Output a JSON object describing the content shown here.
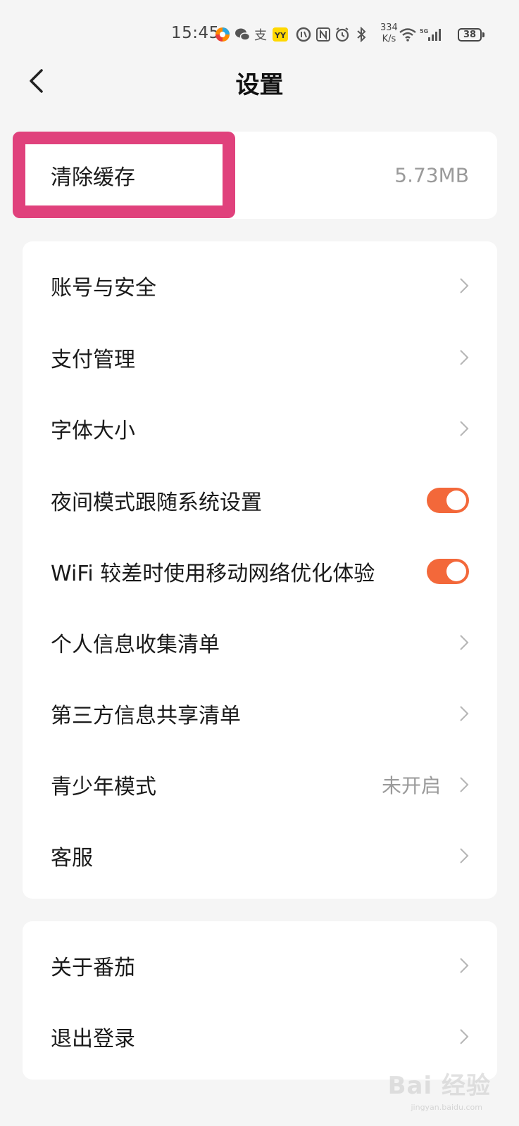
{
  "status_bar": {
    "time": "15:45",
    "net_speed_value": "334",
    "net_speed_unit": "K/s",
    "network": "5G",
    "battery": "38",
    "icons": [
      "app-icon",
      "wechat-icon",
      "alipay-icon",
      "yy-icon",
      "battery-saver-icon",
      "nfc-icon",
      "alarm-icon",
      "bluetooth-icon",
      "wifi-icon",
      "signal-icon"
    ]
  },
  "header": {
    "title": "设置"
  },
  "cache_card": {
    "label": "清除缓存",
    "size": "5.73MB"
  },
  "settings_card": {
    "items": [
      {
        "label": "账号与安全",
        "control": "chevron"
      },
      {
        "label": "支付管理",
        "control": "chevron"
      },
      {
        "label": "字体大小",
        "control": "chevron"
      },
      {
        "label": "夜间模式跟随系统设置",
        "control": "toggle",
        "on": true
      },
      {
        "label": "WiFi 较差时使用移动网络优化体验",
        "control": "toggle",
        "on": true
      },
      {
        "label": "个人信息收集清单",
        "control": "chevron"
      },
      {
        "label": "第三方信息共享清单",
        "control": "chevron"
      },
      {
        "label": "青少年模式",
        "control": "chevron",
        "value": "未开启"
      },
      {
        "label": "客服",
        "control": "chevron"
      }
    ]
  },
  "about_card": {
    "items": [
      {
        "label": "关于番茄",
        "control": "chevron"
      },
      {
        "label": "退出登录",
        "control": "chevron"
      }
    ]
  },
  "watermark": {
    "text": "Bai 经验",
    "sub": "jingyan.baidu.com"
  },
  "colors": {
    "accent_toggle": "#f3683a",
    "highlight": "#e0417c",
    "background": "#f5f5f5"
  }
}
